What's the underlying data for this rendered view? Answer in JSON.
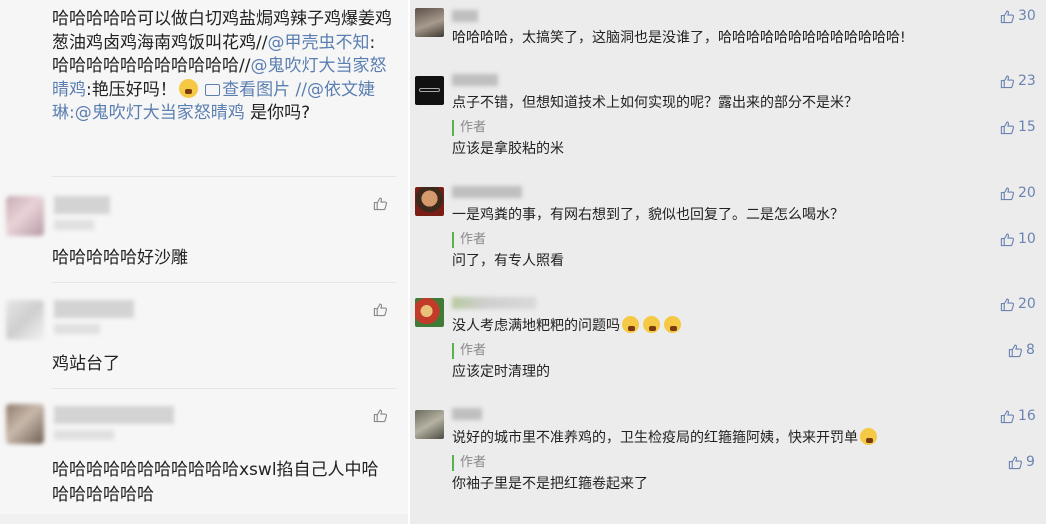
{
  "left": {
    "top_comment": {
      "segments": [
        {
          "t": "哈哈哈哈哈可以做白切鸡盐焗鸡辣子鸡爆姜鸡葱油鸡卤鸡海南鸡饭叫花鸡//",
          "c": "text"
        },
        {
          "t": "@甲壳虫不知",
          "c": "mention"
        },
        {
          "t": ": 哈哈哈哈哈哈哈哈哈哈哈//",
          "c": "text"
        },
        {
          "t": "@鬼吹灯大当家怒晴鸡",
          "c": "mention"
        },
        {
          "t": ":艳压好吗！",
          "c": "text"
        },
        {
          "t": "查看图片",
          "c": "imglink"
        },
        {
          "t": " //",
          "c": "mention"
        },
        {
          "t": "@依文婕琳",
          "c": "mention"
        },
        {
          "t": ":",
          "c": "mention"
        },
        {
          "t": "@鬼吹灯大当家怒晴鸡",
          "c": "mention"
        },
        {
          "t": " 是你吗?",
          "c": "text"
        }
      ]
    },
    "comments": [
      {
        "text": "哈哈哈哈哈好沙雕"
      },
      {
        "text": "鸡站台了"
      },
      {
        "text": "哈哈哈哈哈哈哈哈哈哈哈xswl掐自己人中哈哈哈哈哈哈哈"
      }
    ]
  },
  "right": {
    "comments": [
      {
        "name": "聂",
        "text": "哈哈哈哈，太搞笑了，这脑洞也是没谁了，哈哈哈哈哈哈哈哈哈哈哈哈哈!",
        "likes": "30",
        "reply": null
      },
      {
        "name": "匙淑流",
        "text": "点子不错，但想知道技术上如何实现的呢？露出来的部分不是米？",
        "likes": "23",
        "reply": {
          "label": "作者",
          "text": "应该是拿胶粘的米",
          "likes": "15"
        }
      },
      {
        "name": "林",
        "text": "一是鸡粪的事，有网右想到了，貌似也回复了。二是怎么喝水？",
        "likes": "20",
        "reply": {
          "label": "作者",
          "text": "问了，有专人照看",
          "likes": "10"
        }
      },
      {
        "name": "",
        "text": "没人考虑满地粑粑的问题吗",
        "likes": "20",
        "reply": {
          "label": "作者",
          "text": "应该定时清理的",
          "likes": "8"
        }
      },
      {
        "name": "凡",
        "text": "说好的城市里不准养鸡的，卫生检疫局的红箍箍阿姨，快来开罚单",
        "likes": "16",
        "reply": {
          "label": "作者",
          "text": "你袖子里是不是把红箍卷起来了",
          "likes": "9"
        }
      }
    ]
  },
  "icons": {
    "like": "thumbs-up-icon",
    "picture": "picture-icon",
    "emoji": "emoji-icon"
  },
  "colors": {
    "mention": "#5b7fb1",
    "author_bar": "#56b34f",
    "like_count": "#6b84b3"
  }
}
